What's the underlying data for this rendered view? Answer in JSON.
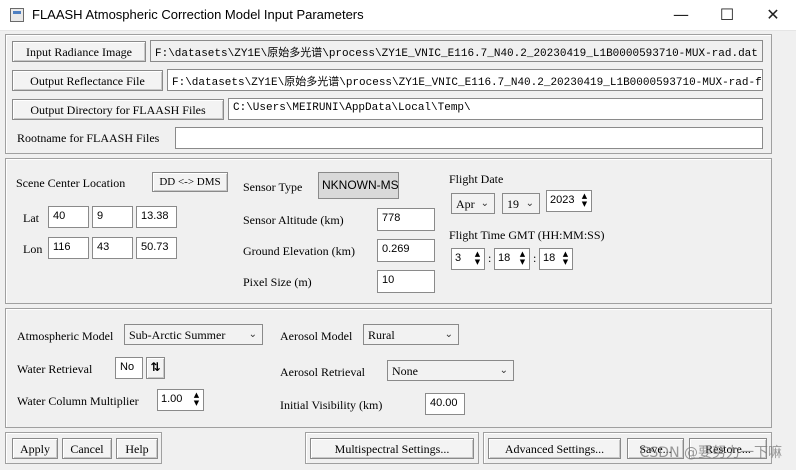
{
  "window": {
    "title": "FLAASH Atmospheric Correction Model Input Parameters",
    "minimize_glyph": "—",
    "maximize_glyph": "☐",
    "close_glyph": "✕"
  },
  "files": {
    "input_radiance_label": "Input Radiance Image",
    "input_radiance_value": "F:\\datasets\\ZY1E\\原始多光谱\\process\\ZY1E_VNIC_E116.7_N40.2_20230419_L1B0000593710-MUX-rad.dat",
    "output_reflectance_label": "Output Reflectance File",
    "output_reflectance_value": "F:\\datasets\\ZY1E\\原始多光谱\\process\\ZY1E_VNIC_E116.7_N40.2_20230419_L1B0000593710-MUX-rad-flaash.d",
    "output_directory_label": "Output Directory for FLAASH Files",
    "output_directory_value": "C:\\Users\\MEIRUNI\\AppData\\Local\\Temp\\",
    "rootname_label": "Rootname for FLAASH Files",
    "rootname_value": ""
  },
  "scene": {
    "center_location_label": "Scene Center Location",
    "dd_dms_button": "DD <-> DMS",
    "lat_label": "Lat",
    "lat_deg": "40",
    "lat_min": "9",
    "lat_sec": "13.38",
    "lon_label": "Lon",
    "lon_deg": "116",
    "lon_min": "43",
    "lon_sec": "50.73",
    "sensor_type_label": "Sensor Type",
    "sensor_type_value": "NKNOWN-MS",
    "sensor_altitude_label": "Sensor Altitude (km)",
    "sensor_altitude_value": "778",
    "ground_elevation_label": "Ground Elevation (km)",
    "ground_elevation_value": "0.269",
    "pixel_size_label": "Pixel Size (m)",
    "pixel_size_value": "10",
    "flight_date_label": "Flight Date",
    "month": "Apr",
    "day": "19",
    "year": "2023",
    "flight_time_label": "Flight Time GMT (HH:MM:SS)",
    "hour": "3",
    "minute": "18",
    "second": "18",
    "time_sep": ":"
  },
  "atmosphere": {
    "model_label": "Atmospheric Model",
    "model_value": "Sub-Arctic Summer",
    "water_retrieval_label": "Water Retrieval",
    "water_retrieval_value": "No",
    "water_toggle_glyph": "⇅",
    "water_column_label": "Water Column Multiplier",
    "water_column_value": "1.00",
    "aerosol_model_label": "Aerosol Model",
    "aerosol_model_value": "Rural",
    "aerosol_retrieval_label": "Aerosol Retrieval",
    "aerosol_retrieval_value": "None",
    "visibility_label": "Initial Visibility (km)",
    "visibility_value": "40.00"
  },
  "footer": {
    "apply": "Apply",
    "cancel": "Cancel",
    "help": "Help",
    "multispectral": "Multispectral Settings...",
    "advanced": "Advanced Settings...",
    "save": "Save...",
    "restore": "Restore..."
  },
  "watermark": "CSDN @要努力一下嘛"
}
